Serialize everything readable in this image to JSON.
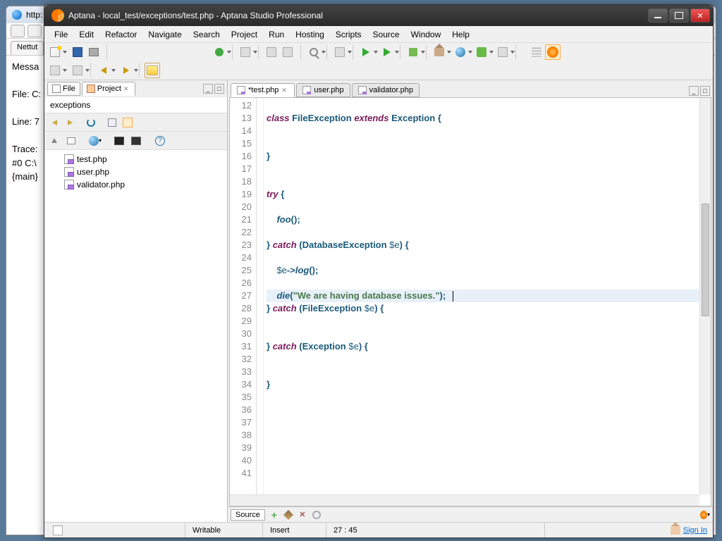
{
  "background_browser": {
    "title_prefix": "http:",
    "tab": "Nettut",
    "body": {
      "msg_label": "Messa",
      "file_label": "File: C:",
      "line_label": "Line: 7",
      "trace_label": "Trace:",
      "trace_0": "#0 C:\\",
      "trace_main": "{main}"
    }
  },
  "ide": {
    "title": "Aptana - local_test/exceptions/test.php - Aptana Studio Professional",
    "menus": [
      "File",
      "Edit",
      "Refactor",
      "Navigate",
      "Search",
      "Project",
      "Run",
      "Hosting",
      "Scripts",
      "Source",
      "Window",
      "Help"
    ],
    "left": {
      "tabs": {
        "file": "File",
        "project": "Project"
      },
      "heading": "exceptions",
      "tree": [
        "test.php",
        "user.php",
        "validator.php"
      ]
    },
    "editor": {
      "tabs": [
        {
          "label": "*test.php",
          "active": true,
          "closeable": true
        },
        {
          "label": "user.php",
          "active": false,
          "closeable": false
        },
        {
          "label": "validator.php",
          "active": false,
          "closeable": false
        }
      ],
      "first_line": 12,
      "lines": [
        {
          "n": 12,
          "html": ""
        },
        {
          "n": 13,
          "html": "<span class='kw'>class</span> <span class='cls'>FileException</span> <span class='kw'>extends</span> <span class='cls'>Exception</span> <span class='punc'>{</span>"
        },
        {
          "n": 14,
          "html": ""
        },
        {
          "n": 15,
          "html": ""
        },
        {
          "n": 16,
          "html": "<span class='punc'>}</span>"
        },
        {
          "n": 17,
          "html": ""
        },
        {
          "n": 18,
          "html": ""
        },
        {
          "n": 19,
          "html": "<span class='kw'>try</span> <span class='punc'>{</span>"
        },
        {
          "n": 20,
          "html": ""
        },
        {
          "n": 21,
          "html": "    <span class='fn'>foo</span><span class='punc'>();</span>"
        },
        {
          "n": 22,
          "html": ""
        },
        {
          "n": 23,
          "html": "<span class='punc'>}</span> <span class='kw'>catch</span> <span class='punc'>(</span><span class='cls'>DatabaseException</span> <span class='var'>$e</span><span class='punc'>) {</span>"
        },
        {
          "n": 24,
          "html": ""
        },
        {
          "n": 25,
          "html": "    <span class='var'>$e</span><span class='punc'>-></span><span class='fn'>log</span><span class='punc'>();</span>"
        },
        {
          "n": 26,
          "html": ""
        },
        {
          "n": 27,
          "html": "    <span class='fn'>die</span><span class='punc'>(</span><span class='str'>\"We are having database issues.\"</span><span class='punc'>);</span>",
          "hl": true,
          "cursor": true
        },
        {
          "n": 28,
          "html": "<span class='punc'>}</span> <span class='kw'>catch</span> <span class='punc'>(</span><span class='cls'>FileException</span> <span class='var'>$e</span><span class='punc'>) {</span>"
        },
        {
          "n": 29,
          "html": ""
        },
        {
          "n": 30,
          "html": ""
        },
        {
          "n": 31,
          "html": "<span class='punc'>}</span> <span class='kw'>catch</span> <span class='punc'>(</span><span class='cls'>Exception</span> <span class='var'>$e</span><span class='punc'>) {</span>"
        },
        {
          "n": 32,
          "html": ""
        },
        {
          "n": 33,
          "html": ""
        },
        {
          "n": 34,
          "html": "<span class='punc'>}</span>"
        },
        {
          "n": 35,
          "html": ""
        },
        {
          "n": 36,
          "html": ""
        },
        {
          "n": 37,
          "html": ""
        },
        {
          "n": 38,
          "html": ""
        },
        {
          "n": 39,
          "html": ""
        },
        {
          "n": 40,
          "html": ""
        },
        {
          "n": 41,
          "html": ""
        }
      ],
      "source_label": "Source"
    },
    "status": {
      "writable": "Writable",
      "insert": "Insert",
      "pos": "27 : 45",
      "signin": "Sign In"
    }
  }
}
